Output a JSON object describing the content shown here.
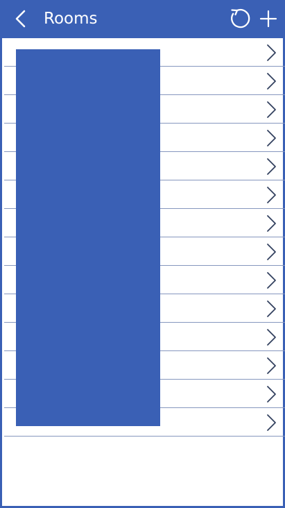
{
  "header": {
    "title": "Rooms",
    "icons": {
      "back": "chevron-left-icon",
      "refresh": "refresh-icon",
      "add": "plus-icon"
    }
  },
  "list": {
    "rows": [
      {
        "icon": "chevron-right-icon"
      },
      {
        "icon": "chevron-right-icon"
      },
      {
        "icon": "chevron-right-icon"
      },
      {
        "icon": "chevron-right-icon"
      },
      {
        "icon": "chevron-right-icon"
      },
      {
        "icon": "chevron-right-icon"
      },
      {
        "icon": "chevron-right-icon"
      },
      {
        "icon": "chevron-right-icon"
      },
      {
        "icon": "chevron-right-icon"
      },
      {
        "icon": "chevron-right-icon"
      },
      {
        "icon": "chevron-right-icon"
      },
      {
        "icon": "chevron-right-icon"
      },
      {
        "icon": "chevron-right-icon"
      },
      {
        "icon": "chevron-right-icon"
      }
    ]
  },
  "colors": {
    "primary": "#3A60B5",
    "divider": "#8596BE",
    "background": "#FFFFFF",
    "header_text": "#FFFFFF",
    "chevron": "#33415F"
  }
}
